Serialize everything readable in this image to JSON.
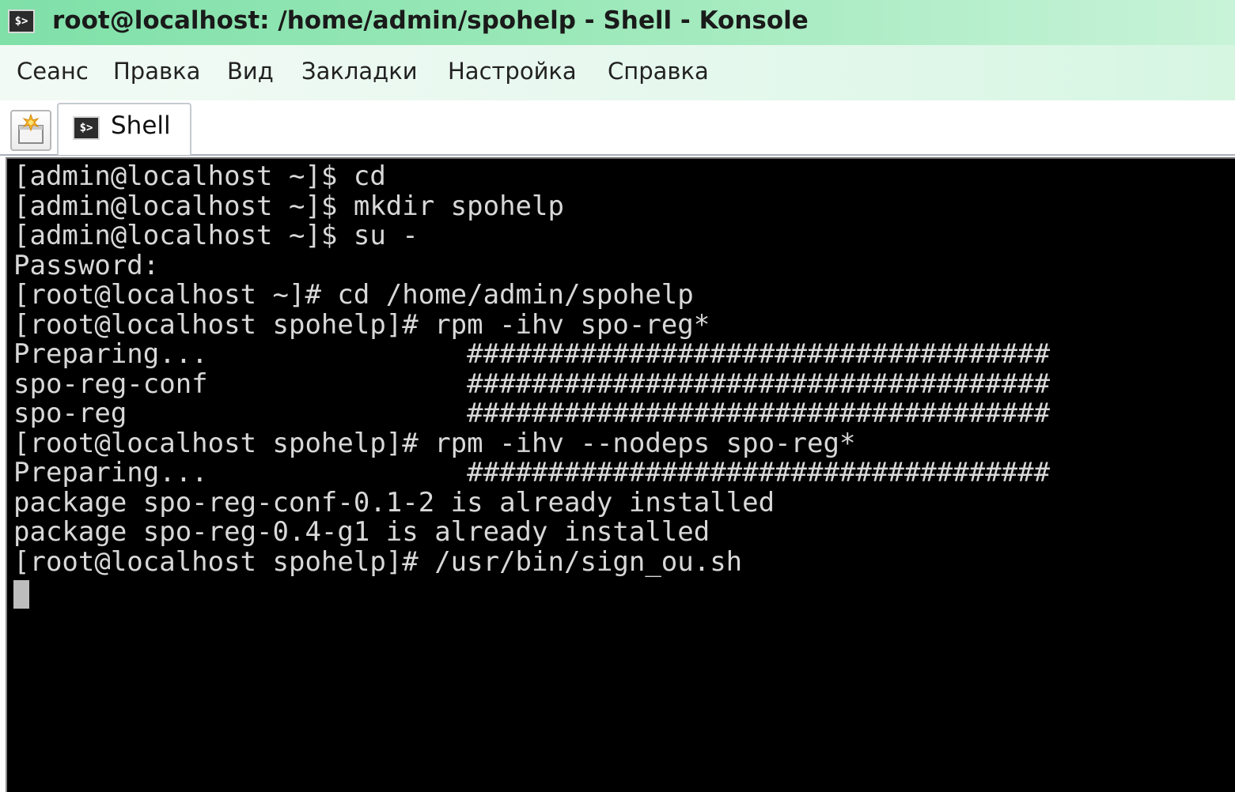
{
  "window": {
    "title": "root@localhost: /home/admin/spohelp - Shell - Konsole",
    "icon": "terminal-icon",
    "icon_text": "$>"
  },
  "menu": {
    "items": [
      {
        "label": "Сеанс"
      },
      {
        "label": "Правка"
      },
      {
        "label": "Вид"
      },
      {
        "label": "Закладки"
      },
      {
        "label": "Настройка"
      },
      {
        "label": "Справка"
      }
    ]
  },
  "tabs": {
    "new_tab_icon": "new-tab-icon",
    "items": [
      {
        "label": "Shell",
        "icon": "terminal-icon",
        "icon_text": "$>",
        "active": true
      }
    ]
  },
  "terminal": {
    "lines": [
      "[admin@localhost ~]$ cd",
      "[admin@localhost ~]$ mkdir spohelp",
      "[admin@localhost ~]$ su -",
      "Password:",
      "[root@localhost ~]# cd /home/admin/spohelp",
      "[root@localhost spohelp]# rpm -ihv spo-reg*",
      "Preparing...                ####################################",
      "spo-reg-conf                ####################################",
      "spo-reg                     ####################################",
      "[root@localhost spohelp]# rpm -ihv --nodeps spo-reg*",
      "Preparing...                ####################################",
      "package spo-reg-conf-0.1-2 is already installed",
      "package spo-reg-0.4-g1 is already installed",
      "[root@localhost spohelp]# /usr/bin/sign_ou.sh"
    ]
  },
  "colors": {
    "titlebar": "#9ae8b8",
    "terminal_bg": "#000000",
    "terminal_fg": "#d8d8d8"
  }
}
